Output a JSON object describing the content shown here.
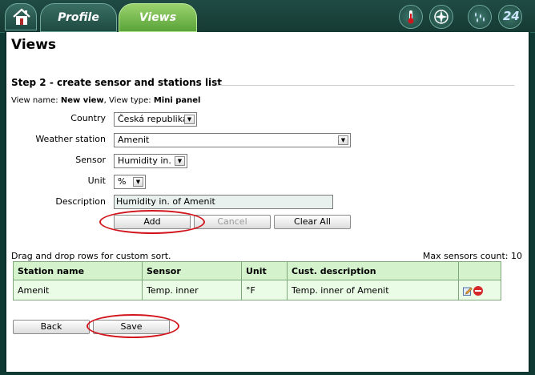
{
  "nav": {
    "tabs": [
      {
        "label": "Profile"
      },
      {
        "label": "Views"
      }
    ],
    "icons": [
      "home-icon",
      "thermometer-icon",
      "compass-icon",
      "rain-icon",
      "24h-icon"
    ],
    "badge_24": "24"
  },
  "page": {
    "title": "Views",
    "step_title": "Step 2 - create sensor and stations list",
    "view_name_label": "View name:",
    "view_name_value": "New view",
    "view_type_label": "View type:",
    "view_type_value": "Mini panel"
  },
  "form": {
    "country_label": "Country",
    "country_value": "Česká republika",
    "station_label": "Weather station",
    "station_value": "Amenit",
    "sensor_label": "Sensor",
    "sensor_value": "Humidity in.",
    "unit_label": "Unit",
    "unit_value": "%",
    "description_label": "Description",
    "description_value": "Humidity in. of Amenit",
    "add_label": "Add",
    "cancel_label": "Cancel",
    "clear_label": "Clear All"
  },
  "list": {
    "drag_hint": "Drag and drop rows for custom sort.",
    "max_label": "Max sensors count: 10",
    "headers": [
      "Station name",
      "Sensor",
      "Unit",
      "Cust. description",
      ""
    ],
    "rows": [
      {
        "station": "Amenit",
        "sensor": "Temp. inner",
        "unit": "°F",
        "description": "Temp. inner of Amenit"
      }
    ]
  },
  "footer": {
    "back_label": "Back",
    "save_label": "Save"
  },
  "colors": {
    "highlight": "#d2151c",
    "tab_active": "#6fbf4a",
    "table_header": "#d4f2cc"
  }
}
